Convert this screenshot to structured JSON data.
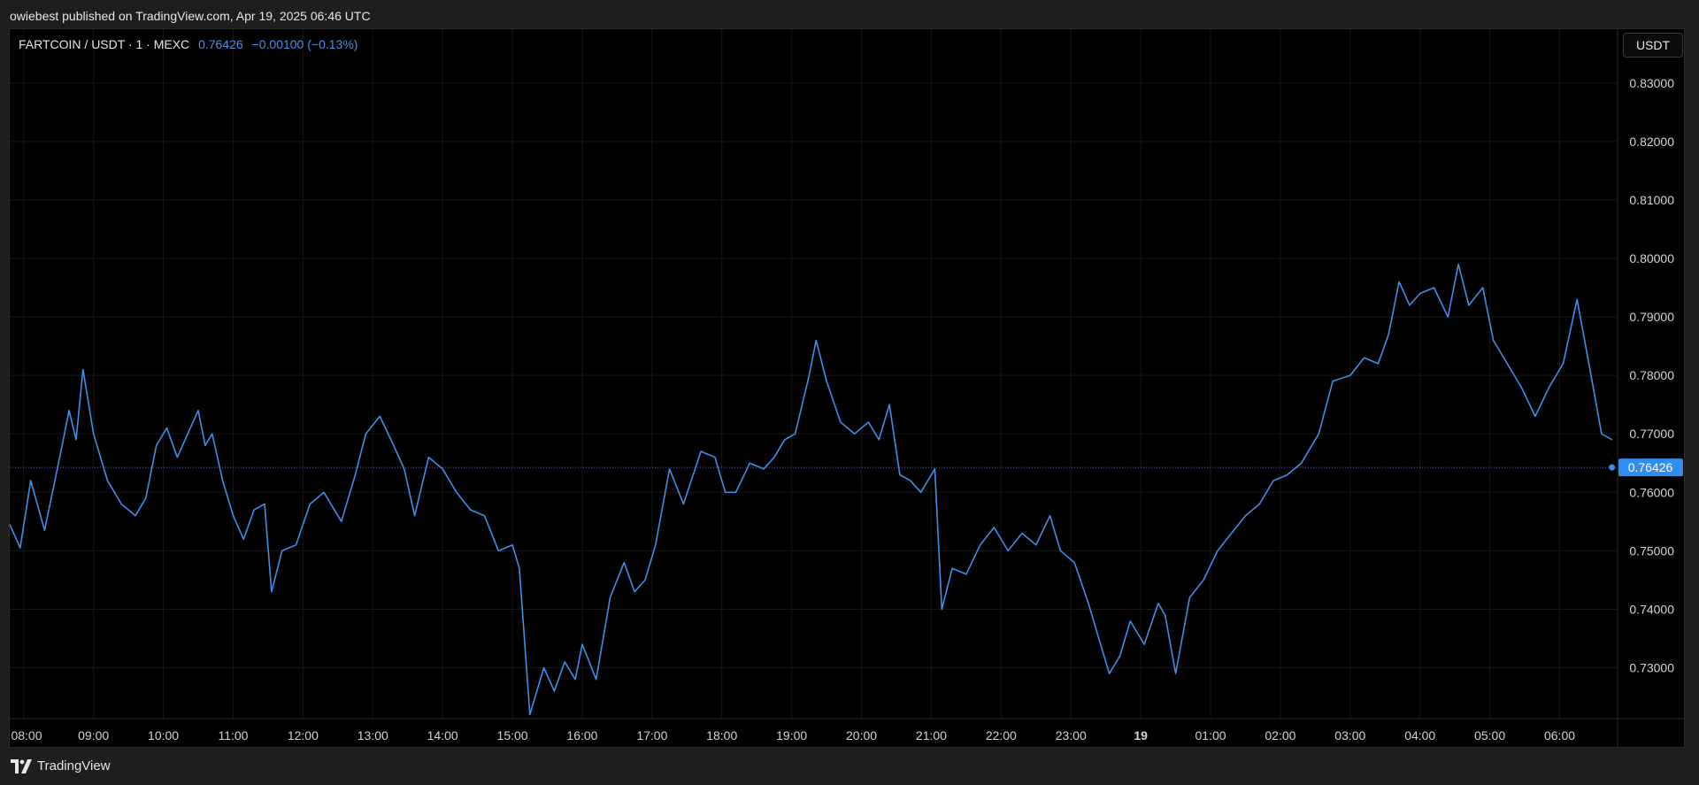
{
  "header": {
    "published": "owiebest published on TradingView.com, Apr 19, 2025 06:46 UTC"
  },
  "legend": {
    "symbol": "FARTCOIN / USDT · 1 · MEXC",
    "price": "0.76426",
    "change": "−0.00100 (−0.13%)"
  },
  "currency_button": "USDT",
  "footer": {
    "brand": "TradingView"
  },
  "colors": {
    "line": "#3d8fea",
    "background": "#000000",
    "grid": "#161616",
    "price_label_bg": "#2f8ef0"
  },
  "chart_data": {
    "type": "line",
    "title": "",
    "xlabel": "",
    "ylabel": "",
    "grid": true,
    "x_ticks": [
      "08:00",
      "09:00",
      "10:00",
      "11:00",
      "12:00",
      "13:00",
      "14:00",
      "15:00",
      "16:00",
      "17:00",
      "18:00",
      "19:00",
      "20:00",
      "21:00",
      "22:00",
      "23:00",
      "19",
      "01:00",
      "02:00",
      "03:00",
      "04:00",
      "05:00",
      "06:00"
    ],
    "x_tick_bold": "19",
    "y_ticks": [
      "0.73000",
      "0.74000",
      "0.75000",
      "0.76000",
      "0.77000",
      "0.78000",
      "0.79000",
      "0.80000",
      "0.81000",
      "0.82000",
      "0.83000"
    ],
    "ylim": [
      0.7213,
      0.8392
    ],
    "xlim_hours": [
      7.8,
      30.83
    ],
    "last_price": 0.76426,
    "last_price_label": "0.76426",
    "series": [
      {
        "x_hours": [
          7.8,
          7.95,
          8.1,
          8.3,
          8.55,
          8.65,
          8.75,
          8.85,
          9.0,
          9.2,
          9.4,
          9.6,
          9.75,
          9.9,
          10.05,
          10.2,
          10.35,
          10.5,
          10.6,
          10.7,
          10.85,
          11.0,
          11.15,
          11.3,
          11.45,
          11.55,
          11.7,
          11.9,
          12.1,
          12.3,
          12.55,
          12.75,
          12.9,
          13.1,
          13.3,
          13.45,
          13.6,
          13.8,
          14.0,
          14.2,
          14.4,
          14.6,
          14.8,
          15.0,
          15.1,
          15.25,
          15.45,
          15.6,
          15.75,
          15.9,
          16.0,
          16.2,
          16.4,
          16.6,
          16.75,
          16.9,
          17.05,
          17.25,
          17.45,
          17.7,
          17.9,
          18.05,
          18.2,
          18.4,
          18.6,
          18.75,
          18.9,
          19.05,
          19.25,
          19.35,
          19.5,
          19.7,
          19.9,
          20.1,
          20.25,
          20.4,
          20.55,
          20.7,
          20.85,
          21.05,
          21.15,
          21.3,
          21.5,
          21.7,
          21.9,
          22.1,
          22.3,
          22.5,
          22.7,
          22.85,
          23.05,
          23.25,
          23.4,
          23.55,
          23.7,
          23.85,
          24.05,
          24.25,
          24.35,
          24.5,
          24.7,
          24.9,
          25.1,
          25.3,
          25.5,
          25.7,
          25.9,
          26.1,
          26.3,
          26.55,
          26.75,
          27.0,
          27.2,
          27.4,
          27.55,
          27.7,
          27.85,
          28.0,
          28.2,
          28.4,
          28.55,
          28.7,
          28.9,
          29.05,
          29.25,
          29.45,
          29.65,
          29.85,
          30.05,
          30.25,
          30.45,
          30.6,
          30.75
        ],
        "values": [
          0.7545,
          0.7505,
          0.762,
          0.7535,
          0.768,
          0.774,
          0.769,
          0.781,
          0.77,
          0.762,
          0.758,
          0.756,
          0.759,
          0.768,
          0.771,
          0.766,
          0.77,
          0.774,
          0.768,
          0.77,
          0.762,
          0.756,
          0.752,
          0.757,
          0.758,
          0.743,
          0.75,
          0.751,
          0.758,
          0.76,
          0.755,
          0.763,
          0.77,
          0.773,
          0.768,
          0.764,
          0.756,
          0.766,
          0.764,
          0.76,
          0.757,
          0.756,
          0.75,
          0.751,
          0.747,
          0.722,
          0.73,
          0.726,
          0.731,
          0.728,
          0.734,
          0.728,
          0.742,
          0.748,
          0.743,
          0.745,
          0.751,
          0.764,
          0.758,
          0.767,
          0.766,
          0.76,
          0.76,
          0.765,
          0.764,
          0.766,
          0.769,
          0.77,
          0.78,
          0.786,
          0.779,
          0.772,
          0.77,
          0.772,
          0.769,
          0.775,
          0.763,
          0.762,
          0.76,
          0.764,
          0.74,
          0.747,
          0.746,
          0.751,
          0.754,
          0.75,
          0.753,
          0.751,
          0.756,
          0.75,
          0.748,
          0.741,
          0.735,
          0.729,
          0.732,
          0.738,
          0.734,
          0.741,
          0.739,
          0.729,
          0.742,
          0.745,
          0.75,
          0.753,
          0.756,
          0.758,
          0.762,
          0.763,
          0.765,
          0.77,
          0.779,
          0.78,
          0.783,
          0.782,
          0.787,
          0.796,
          0.792,
          0.794,
          0.795,
          0.79,
          0.799,
          0.792,
          0.795,
          0.786,
          0.782,
          0.778,
          0.773,
          0.778,
          0.782,
          0.793,
          0.78,
          0.77,
          0.769,
          0.767,
          0.76426
        ]
      }
    ]
  }
}
